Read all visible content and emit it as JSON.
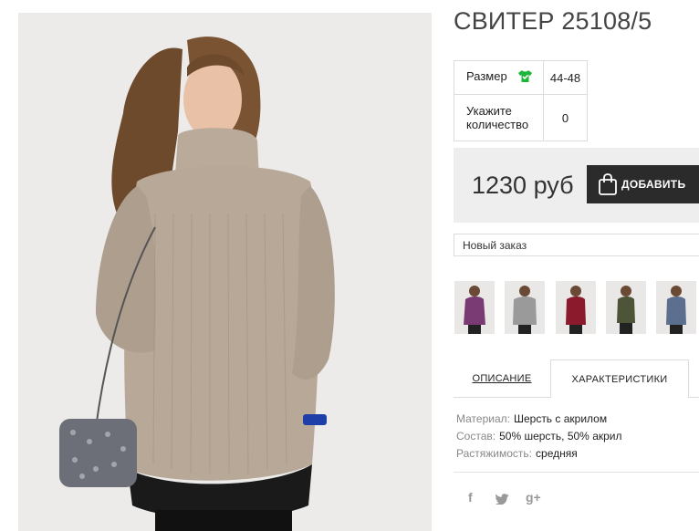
{
  "product": {
    "title": "СВИТЕР 25108/5",
    "main_image": "sweater-model-photo"
  },
  "options": {
    "size_label": "Размер",
    "size_icon": "tshirt-icon",
    "size_value": "44-48",
    "qty_label": "Укажите количество",
    "qty_value": "0"
  },
  "purchase": {
    "price": "1230 руб",
    "add_label": "ДОБАВИТЬ",
    "bag_icon": "shopping-bag-icon"
  },
  "order": {
    "selected": "Новый заказ"
  },
  "thumbnails": [
    {
      "name": "thumb-purple",
      "color": "#7a3a73"
    },
    {
      "name": "thumb-gray",
      "color": "#9a9a9a"
    },
    {
      "name": "thumb-burgundy",
      "color": "#8a1a2c"
    },
    {
      "name": "thumb-olive",
      "color": "#4e5438"
    },
    {
      "name": "thumb-blue",
      "color": "#5d6f8e"
    }
  ],
  "tabs": {
    "description": "ОПИСАНИЕ",
    "characteristics": "ХАРАКТЕРИСТИКИ"
  },
  "specs": {
    "material_key": "Материал:",
    "material_val": "Шерсть с акрилом",
    "composition_key": "Состав:",
    "composition_val": "50% шерсть, 50% акрил",
    "stretch_key": "Растяжимость:",
    "stretch_val": "средняя"
  },
  "social": {
    "facebook": "f",
    "twitter_icon": "twitter-icon",
    "googleplus": "g+"
  }
}
